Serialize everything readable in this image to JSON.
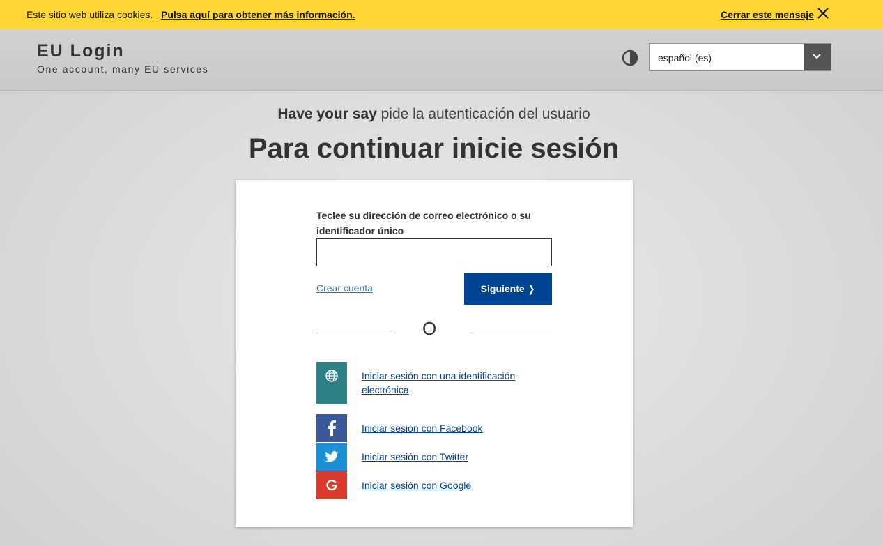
{
  "cookie_bar": {
    "text": "Este sitio web utiliza cookies.",
    "info_link": "Pulsa aquí para obtener más información.",
    "close_label": "Cerrar este mensaje"
  },
  "header": {
    "title": "EU Login",
    "subtitle": "One account, many EU services",
    "language": {
      "selected": "español (es)"
    }
  },
  "intro": {
    "app_name": "Have your say",
    "app_suffix": " pide la autenticación del usuario",
    "heading": "Para continuar inicie sesión"
  },
  "login_form": {
    "field_label": "Teclee su dirección de correo electrónico o su identificador único",
    "email_value": "",
    "create_account": "Crear cuenta",
    "next_button": "Siguiente ❭",
    "separator": "O"
  },
  "providers": [
    {
      "name": "eid",
      "icon": "globe-icon",
      "color": "#2e8285",
      "label": "Iniciar sesión con una identificación electrónica"
    },
    {
      "name": "facebook",
      "icon": "facebook-icon",
      "color": "#3b5998",
      "label": "Iniciar sesión con Facebook"
    },
    {
      "name": "twitter",
      "icon": "twitter-icon",
      "color": "#1d8fd6",
      "label": "Iniciar sesión con Twitter"
    },
    {
      "name": "google",
      "icon": "google-icon",
      "color": "#db3b2f",
      "label": "Iniciar sesión con Google"
    }
  ],
  "colors": {
    "cookie_bar": "#ffd633",
    "primary_button": "#004494",
    "link": "#004494"
  }
}
